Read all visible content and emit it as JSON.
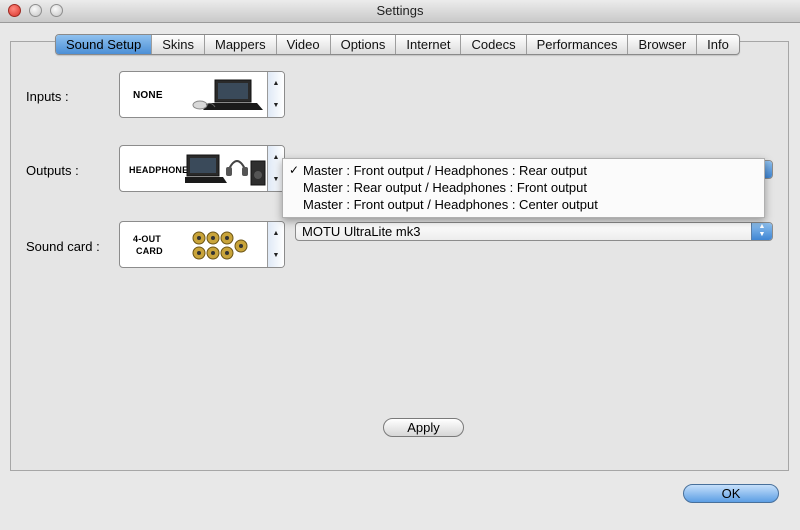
{
  "window": {
    "title": "Settings"
  },
  "tabs": [
    "Sound Setup",
    "Skins",
    "Mappers",
    "Video",
    "Options",
    "Internet",
    "Codecs",
    "Performances",
    "Browser",
    "Info"
  ],
  "inputs": {
    "label": "Inputs :",
    "picker_text": "NONE"
  },
  "outputs": {
    "label": "Outputs :",
    "picker_text": "HEADPHONES",
    "menu": [
      {
        "text": "Master : Front output / Headphones : Rear output",
        "checked": true
      },
      {
        "text": "Master : Rear output / Headphones : Front output",
        "checked": false
      },
      {
        "text": "Master : Front output / Headphones : Center output",
        "checked": false
      }
    ],
    "check_glyph": "✓"
  },
  "sound_card": {
    "label": "Sound card :",
    "picker_line1": "4-OUT",
    "picker_line2": "CARD",
    "selected": "MOTU UltraLite mk3"
  },
  "buttons": {
    "apply": "Apply",
    "ok": "OK"
  },
  "colors": {
    "accent": "#4c8fd6",
    "panel": "#e5e5e5",
    "close": "#d9332b"
  }
}
